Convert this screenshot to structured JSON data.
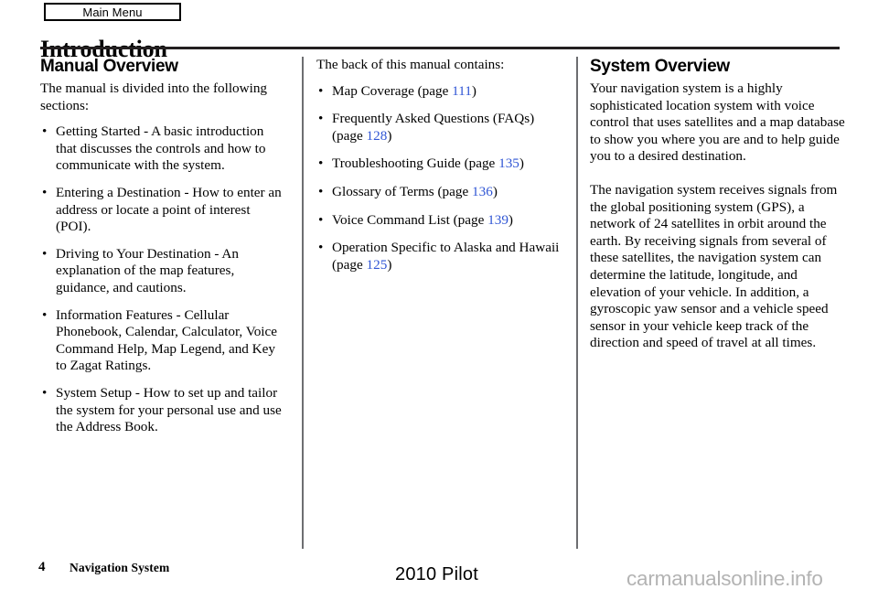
{
  "header": {
    "main_menu_label": "Main Menu",
    "page_title": "Introduction"
  },
  "columns": {
    "left": {
      "heading": "Manual Overview",
      "intro": "The manual is divided into the following sections:",
      "bullets": [
        "Getting Started - A basic introduction that discusses the controls and how to communicate with the system.",
        "Entering a Destination - How to enter an address or locate a point of interest (POI).",
        "Driving to Your Destination - An explanation of the map features, guidance, and cautions.",
        "Information Features - Cellular Phonebook, Calendar, Calculator, Voice Command Help, Map Legend, and Key to Zagat Ratings.",
        "System Setup - How to set up and tailor the system for your personal use and use the Address Book."
      ],
      "bullet_marker": "•"
    },
    "middle": {
      "intro": "The back of this manual contains:",
      "bullets": [
        {
          "text_before": "Map Coverage (page ",
          "page": "111",
          "text_after": ")"
        },
        {
          "text_before": "Frequently Asked Questions (FAQs) (page ",
          "page": "128",
          "text_after": ")"
        },
        {
          "text_before": "Troubleshooting Guide (page ",
          "page": "135",
          "text_after": ")"
        },
        {
          "text_before": "Glossary of Terms (page ",
          "page": "136",
          "text_after": ")"
        },
        {
          "text_before": "Voice Command List (page ",
          "page": "139",
          "text_after": ")"
        },
        {
          "text_before": "Operation Specific to Alaska and Hawaii (page ",
          "page": "125",
          "text_after": ")"
        }
      ],
      "bullet_marker": "•"
    },
    "right": {
      "heading": "System Overview",
      "paragraphs": [
        "Your navigation system is a highly sophisticated location system with voice control that uses satellites and a map database to show you where you are and to help guide you to a desired destination.",
        "The navigation system receives signals from the global positioning system (GPS), a network of 24 satellites in orbit around the earth. By receiving signals from several of these satellites, the navigation system can determine the latitude, longitude, and elevation of your vehicle. In addition, a gyroscopic yaw sensor and a vehicle speed sensor in your vehicle keep track of the direction and speed of travel at all times."
      ]
    }
  },
  "footer": {
    "page_number": "4",
    "section_name": "Navigation System",
    "model": "2010 Pilot",
    "watermark": "carmanualsonline.info"
  },
  "colors": {
    "page_reference_blue": "#2f55d4",
    "rule_black": "#231f20",
    "divider_gray": "#6d6e71",
    "watermark_gray": "#b3b3b3"
  }
}
